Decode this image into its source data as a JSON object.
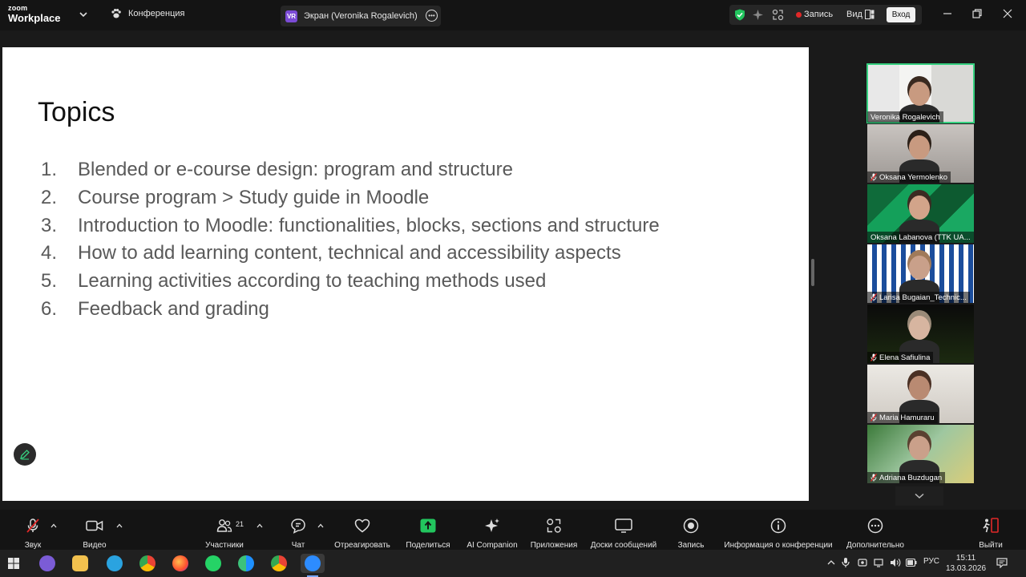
{
  "app": {
    "logo_line1": "zoom",
    "logo_line2": "Workplace",
    "meeting_tab": "Конференция",
    "share_tab_badge": "VR",
    "share_tab_label": "Экран (Veronika Rogalevich)",
    "record_label": "Запись",
    "view_label": "Вид",
    "login_label": "Вход"
  },
  "slide": {
    "title": "Topics",
    "items": [
      {
        "num": "1.",
        "text": "Blended or e-course design: program and structure"
      },
      {
        "num": "2.",
        "text": "Course program > Study guide in Moodle"
      },
      {
        "num": "3.",
        "text": "Introduction to Moodle: functionalities, blocks, sections and structure"
      },
      {
        "num": "4.",
        "text": "How to add learning content, technical and accessibility aspects"
      },
      {
        "num": "5.",
        "text": "Learning activities according to teaching methods used"
      },
      {
        "num": "6.",
        "text": "Feedback and grading"
      }
    ]
  },
  "participants": [
    {
      "name": "Veronika Rogalevich",
      "muted": false,
      "active": true
    },
    {
      "name": "Oksana Yermolenko",
      "muted": true,
      "active": false
    },
    {
      "name": "Oksana Labanova (TTK UA...",
      "muted": false,
      "active": false
    },
    {
      "name": "Larisa Bugaian_Technic...",
      "muted": true,
      "active": false
    },
    {
      "name": "Elena Safiulina",
      "muted": true,
      "active": false
    },
    {
      "name": "Maria Hamuraru",
      "muted": true,
      "active": false
    },
    {
      "name": "Adriana Buzdugan",
      "muted": true,
      "active": false
    }
  ],
  "toolbar": {
    "audio": "Звук",
    "video": "Видео",
    "participants": "Участники",
    "participants_count": "21",
    "chat": "Чат",
    "react": "Отреагировать",
    "share": "Поделиться",
    "ai": "AI Companion",
    "apps": "Приложения",
    "whiteboards": "Доски сообщений",
    "record": "Запись",
    "info": "Информация о конференции",
    "more": "Дополнительно",
    "leave": "Выйти"
  },
  "taskbar": {
    "lang": "РУС",
    "time": "15:11",
    "date": "13.03.2026"
  },
  "colors": {
    "active_speaker": "#35d07f",
    "share_green": "#22c55e",
    "record_red": "#e02828",
    "leave_red": "#e02828"
  }
}
